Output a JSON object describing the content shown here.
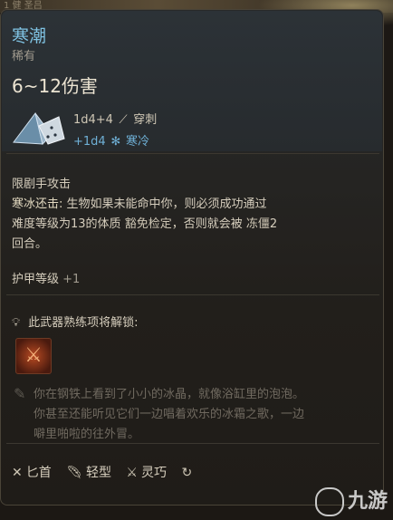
{
  "background": {
    "top_text": "1 健 圣吕"
  },
  "item": {
    "name": "寒潮",
    "rarity": "稀有",
    "damage": "6~12伤害",
    "damage_dice": "1d4+4",
    "damage_type": "穿刺",
    "bonus_dice": "+1d4",
    "bonus_type": "寒冷",
    "pierce_icon": "dagger-icon",
    "cold_icon": "snowflake-icon"
  },
  "ability": {
    "type": "限剧手攻击",
    "name": "寒冰还击:",
    "text1": " 生物如果未能命中你，则必须成功通过",
    "text2a": "难度等级为13的体质 ",
    "save": "豁免检定",
    "text2b": "，否则就会被 ",
    "status": "冻僵",
    "text2c": "2",
    "text3": "回合。"
  },
  "armor": {
    "label": "护甲等级",
    "value": "+1"
  },
  "unlock": {
    "label": "此武器熟练项将解锁:",
    "icon": "lightbulb-icon"
  },
  "lore": {
    "line1": "你在钢铁上看到了小小的冰晶，就像浴缸里的泡泡。",
    "line2": "你甚至还能听见它们一边唱着欢乐的冰霜之歌，一边",
    "line3": "噼里啪啦的往外冒。"
  },
  "properties": [
    {
      "label": "匕首",
      "icon": "crossed-daggers-icon"
    },
    {
      "label": "轻型",
      "icon": "feather-icon"
    },
    {
      "label": "灵巧",
      "icon": "finesse-icon"
    }
  ],
  "watermark": {
    "text": "九游"
  }
}
